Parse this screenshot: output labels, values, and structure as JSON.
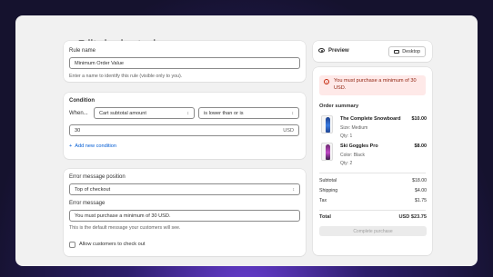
{
  "page": {
    "title": "Edit checkout rule"
  },
  "rule_name": {
    "label": "Rule name",
    "value": "Minimum Order Value",
    "hint": "Enter a name to identify this rule (visible only to you)."
  },
  "condition": {
    "heading": "Condition",
    "when_select": "When...",
    "field_select": "Cart subtotal amount",
    "operator_select": "is lower than or is",
    "amount_value": "30",
    "amount_suffix": "USD",
    "add_condition": "Add new condition"
  },
  "error": {
    "position_label": "Error message position",
    "position_value": "Top of checkout",
    "message_label": "Error message",
    "message_value": "You must purchase a minimum of 30 USD.",
    "message_hint": "This is the default message your customers will see.",
    "allow_checkbox_label": "Allow customers to check out",
    "allow_checked": false
  },
  "preview": {
    "label": "Preview",
    "device_button": "Desktop",
    "banner_message": "You must purchase a minimum of 30 USD.",
    "order_summary_title": "Order summary",
    "items": [
      {
        "name": "The Complete Snowboard",
        "meta1": "Size: Medium",
        "meta2": "Qty: 1",
        "price": "$10.00"
      },
      {
        "name": "Ski Goggles Pro",
        "meta1": "Color: Black",
        "meta2": "Qty: 2",
        "price": "$8.00"
      }
    ],
    "subtotal_label": "Subtotal",
    "subtotal_value": "$18.00",
    "shipping_label": "Shipping",
    "shipping_value": "$4.00",
    "tax_label": "Tax",
    "tax_value": "$1.75",
    "total_label": "Total",
    "total_value": "USD $23.75",
    "complete_button": "Complete purchase"
  },
  "colors": {
    "accent_link": "#005bd3",
    "error_bg": "#fee9e8",
    "error_text": "#8e1f0b"
  }
}
